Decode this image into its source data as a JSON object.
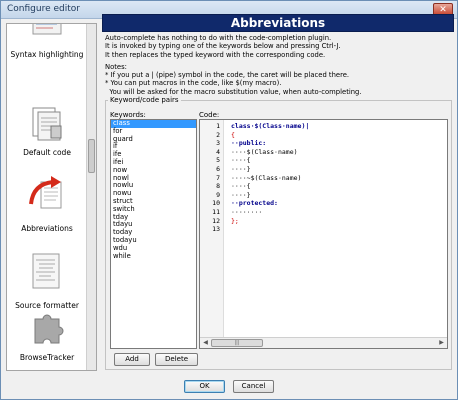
{
  "window": {
    "title": "Configure editor",
    "close_glyph": "✕"
  },
  "sidebar": {
    "items": [
      {
        "label": "Syntax highlighting",
        "icon": "syntax-highlighting-icon"
      },
      {
        "label": "Default code",
        "icon": "default-code-icon"
      },
      {
        "label": "Abbreviations",
        "icon": "abbreviations-icon"
      },
      {
        "label": "Source formatter",
        "icon": "source-formatter-icon"
      },
      {
        "label": "BrowseTracker",
        "icon": "puzzle-piece-icon"
      }
    ]
  },
  "page": {
    "heading": "Abbreviations",
    "description": [
      "Auto-complete has nothing to do with the code-completion plugin.",
      "It is invoked by typing one of the keywords below and pressing Ctrl-J.",
      "It then replaces the typed keyword with the corresponding code.",
      "",
      "Notes:",
      "* If you put a | (pipe) symbol in the code, the caret will be placed there.",
      "* You can put macros in the code, like $(my macro).",
      "  You will be asked for the macro substitution value, when auto-completing."
    ],
    "group_label": "Keyword/code pairs",
    "keywords_label": "Keywords:",
    "code_label": "Code:"
  },
  "keywords": {
    "selected": "class",
    "items": [
      "class",
      "for",
      "guard",
      "if",
      "ife",
      "ifei",
      "now",
      "nowl",
      "nowlu",
      "nowu",
      "struct",
      "switch",
      "tday",
      "tdayu",
      "today",
      "todayu",
      "wdu",
      "while"
    ]
  },
  "code": {
    "line_numbers": [
      "1",
      "2",
      "3",
      "4",
      "5",
      "6",
      "7",
      "8",
      "9",
      "10",
      "11",
      "12",
      "13"
    ],
    "lines": [
      "class·$(Class·name)|",
      "{",
      "··public:",
      "····$(Class·name)",
      "····{",
      "····}",
      "····~$(Class·name)",
      "····{",
      "····}",
      "··protected:",
      "········",
      "};",
      ""
    ]
  },
  "buttons": {
    "add": "Add",
    "delete": "Delete",
    "ok": "OK",
    "cancel": "Cancel"
  },
  "colors": {
    "header_bg": "#10296b",
    "selection": "#3399ff",
    "keyword": "#00008b",
    "bracket": "#cc0000"
  }
}
